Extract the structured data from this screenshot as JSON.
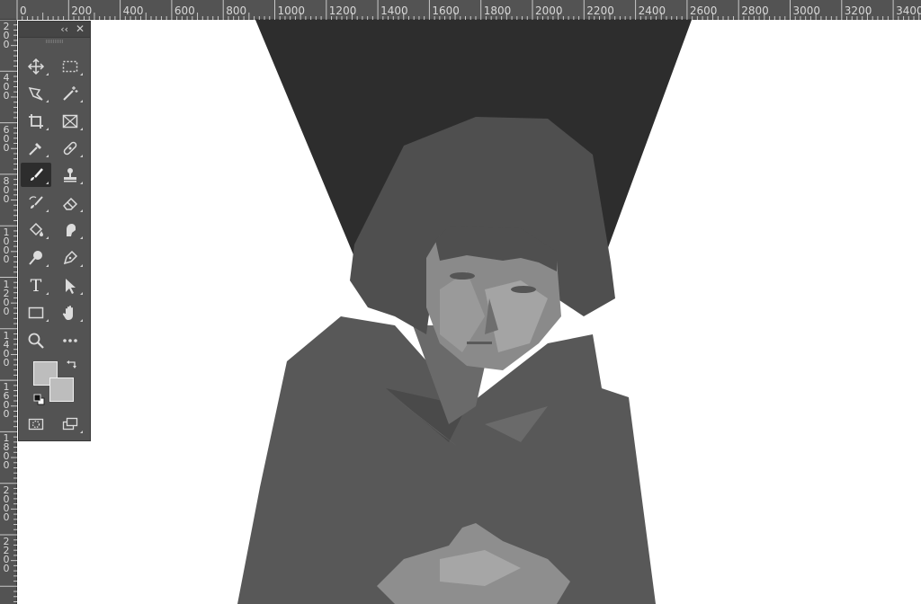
{
  "ruler": {
    "top_labels": [
      "0",
      "200",
      "400",
      "600",
      "800",
      "1000",
      "1200",
      "1400",
      "1600",
      "1800",
      "2000",
      "2200",
      "2400",
      "2600",
      "2800",
      "3000",
      "3200",
      "3400"
    ],
    "left_labels": [
      "200",
      "400",
      "600",
      "800",
      "1000",
      "1200",
      "1400",
      "1600",
      "1800",
      "2000",
      "2200"
    ]
  },
  "toolbar": {
    "collapse_label": "‹‹",
    "close_label": "✕",
    "tools": [
      {
        "name": "move-tool",
        "icon": "move-icon",
        "active": false
      },
      {
        "name": "rectangular-marquee-tool",
        "icon": "marquee-icon",
        "active": false
      },
      {
        "name": "lasso-tool",
        "icon": "polygonal-lasso-icon",
        "active": false
      },
      {
        "name": "magic-wand-tool",
        "icon": "magic-wand-icon",
        "active": false
      },
      {
        "name": "crop-tool",
        "icon": "crop-icon",
        "active": false
      },
      {
        "name": "frame-tool",
        "icon": "frame-icon",
        "active": false
      },
      {
        "name": "eyedropper-tool",
        "icon": "eyedropper-icon",
        "active": false
      },
      {
        "name": "healing-brush-tool",
        "icon": "bandage-icon",
        "active": false
      },
      {
        "name": "brush-tool",
        "icon": "brush-icon",
        "active": true
      },
      {
        "name": "clone-stamp-tool",
        "icon": "stamp-icon",
        "active": false
      },
      {
        "name": "history-brush-tool",
        "icon": "history-brush-icon",
        "active": false
      },
      {
        "name": "eraser-tool",
        "icon": "eraser-icon",
        "active": false
      },
      {
        "name": "paint-bucket-tool",
        "icon": "paint-bucket-icon",
        "active": false
      },
      {
        "name": "smudge-tool",
        "icon": "smudge-icon",
        "active": false
      },
      {
        "name": "dodge-tool",
        "icon": "dodge-icon",
        "active": false
      },
      {
        "name": "pen-tool",
        "icon": "pen-icon",
        "active": false
      },
      {
        "name": "type-tool",
        "icon": "type-icon",
        "active": false
      },
      {
        "name": "path-selection-tool",
        "icon": "arrow-icon",
        "active": false
      },
      {
        "name": "rectangle-tool",
        "icon": "rectangle-icon",
        "active": false
      },
      {
        "name": "hand-tool",
        "icon": "hand-icon",
        "active": false
      },
      {
        "name": "zoom-tool",
        "icon": "zoom-icon",
        "active": false
      },
      {
        "name": "more-tools",
        "icon": "ellipsis-icon",
        "active": false
      },
      {
        "name": "quick-mask-button",
        "icon": "quick-mask-icon",
        "active": false
      },
      {
        "name": "screen-mode-button",
        "icon": "screen-mode-icon",
        "active": false
      }
    ],
    "type_glyph": "T",
    "foreground_color": "#bdbdbd",
    "background_color": "#bdbdbd"
  },
  "colors": {
    "panel_bg": "#535353",
    "ruler_bg": "#535353",
    "canvas_bg": "#ffffff"
  }
}
